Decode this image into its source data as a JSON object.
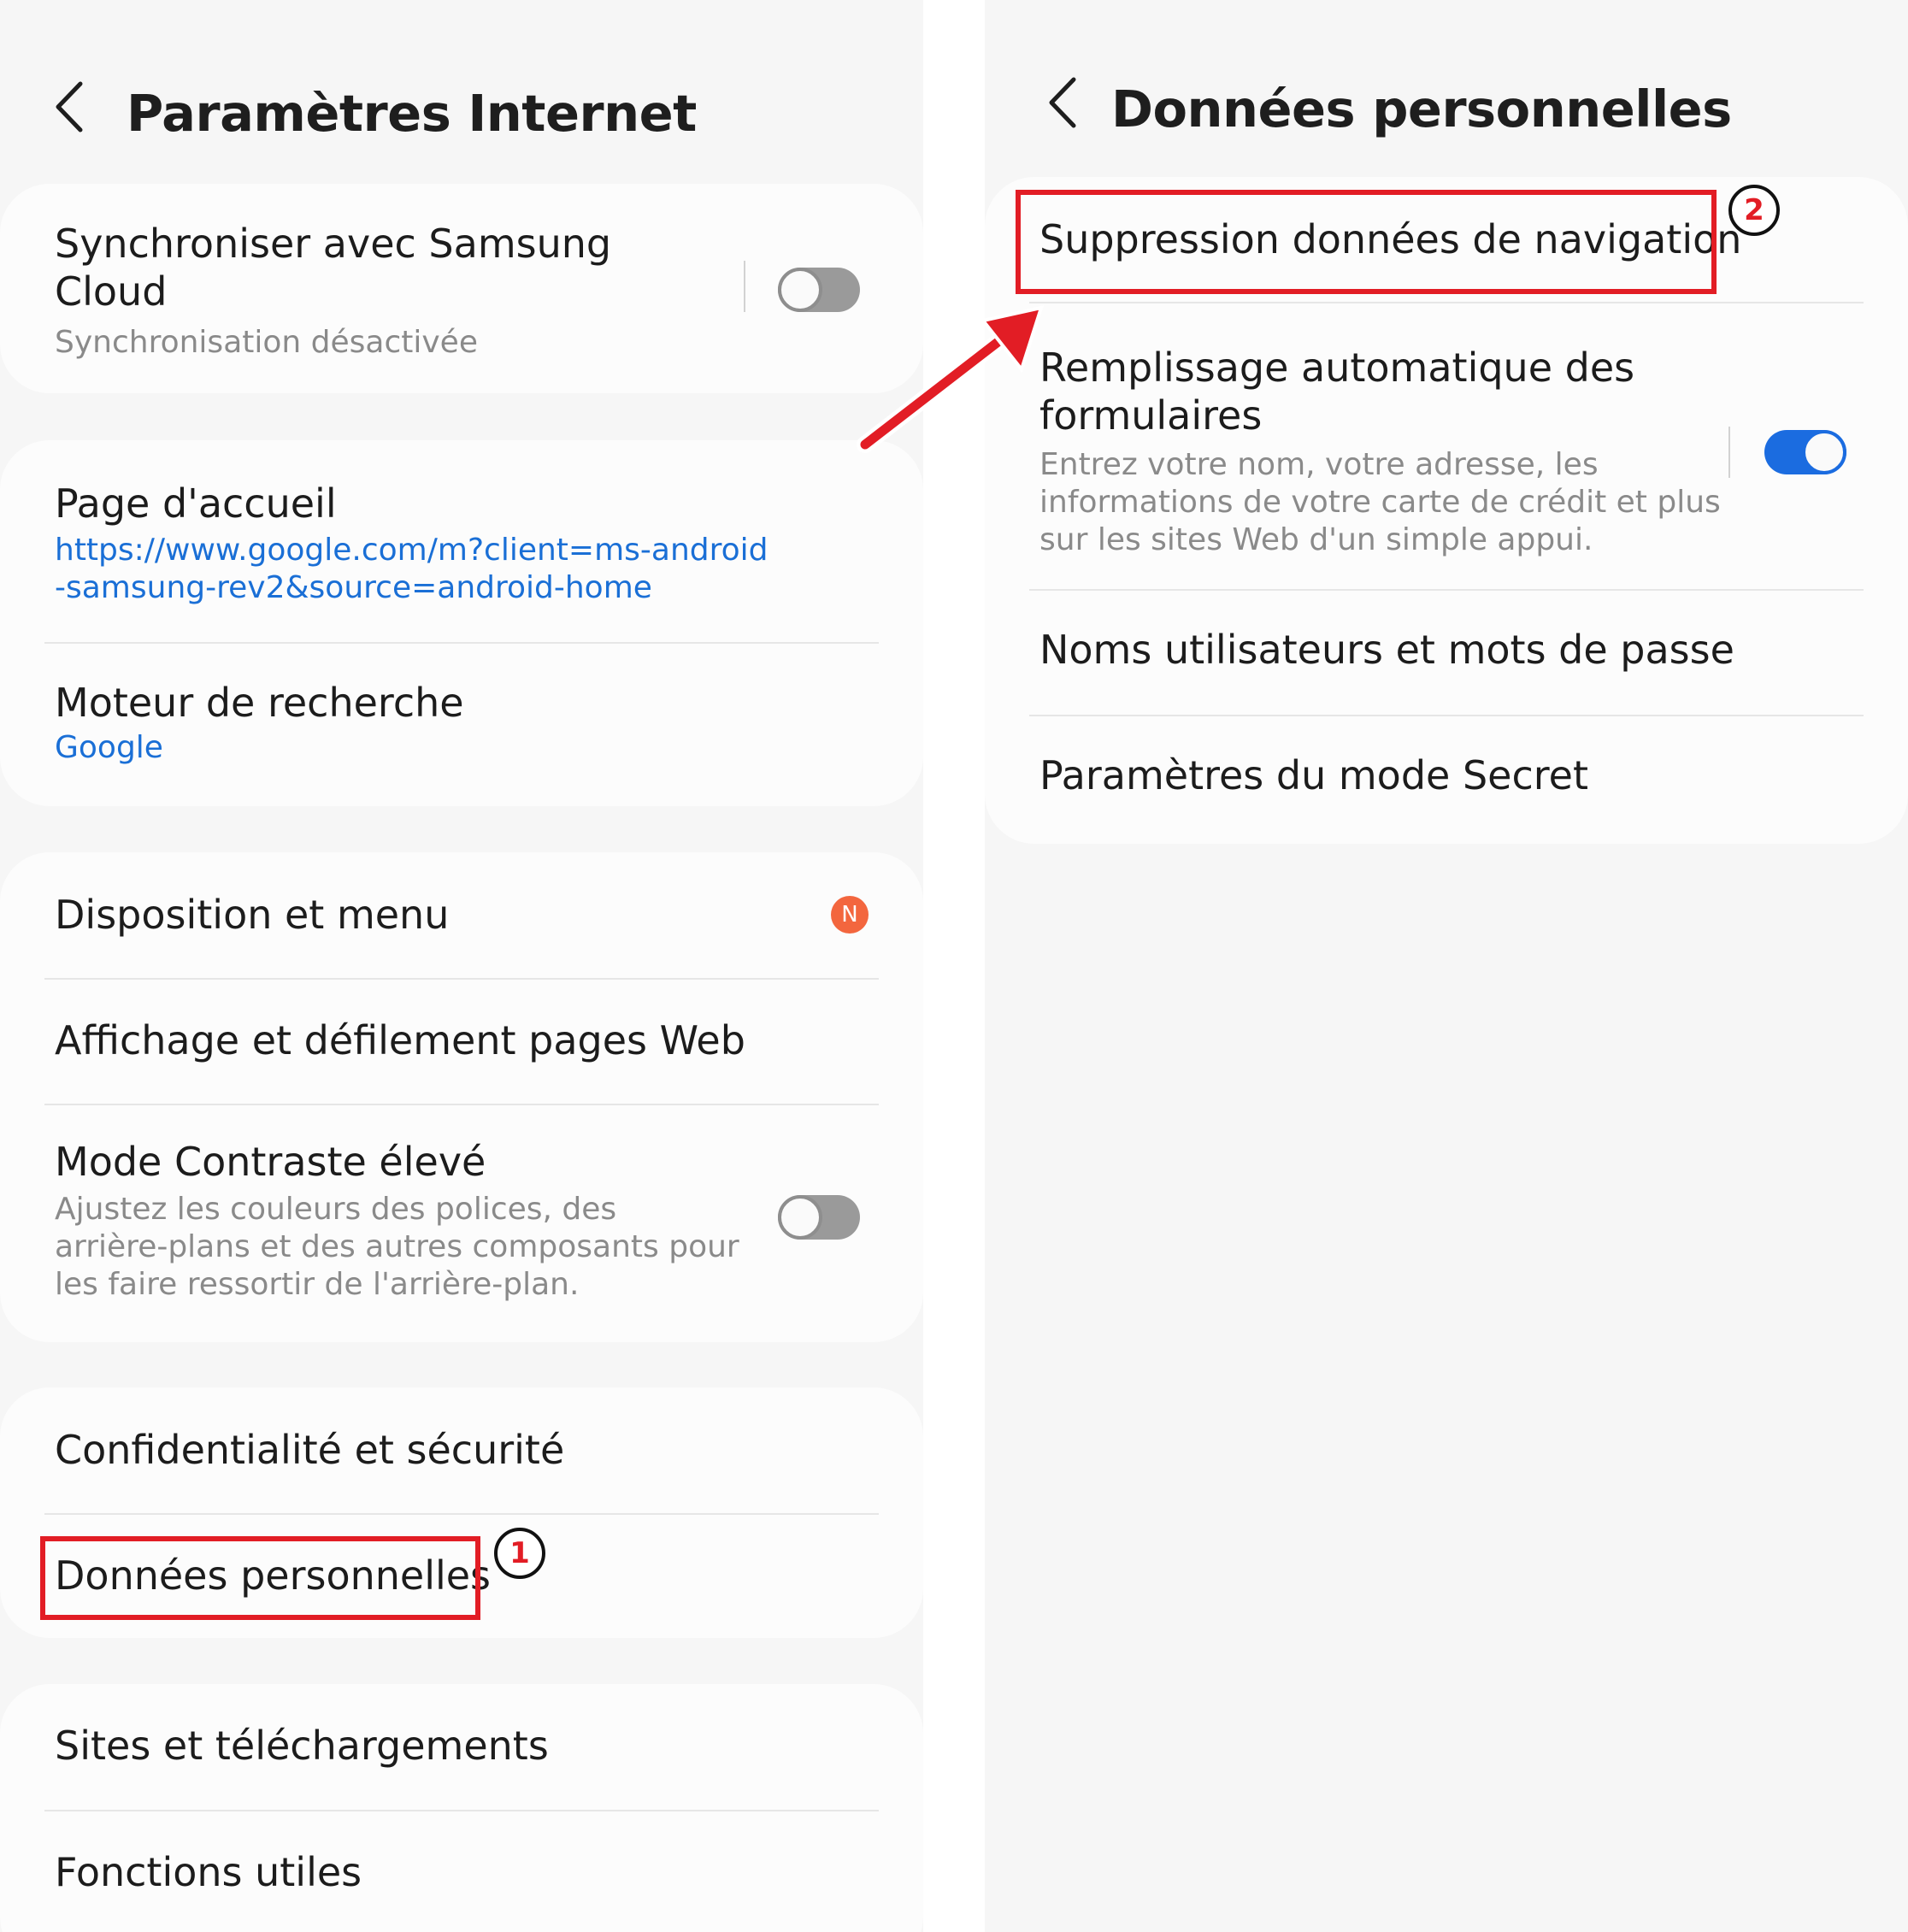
{
  "left_panel": {
    "title": "Paramètres Internet",
    "sync": {
      "title_line1": "Synchroniser avec Samsung",
      "title_line2": "Cloud",
      "subtitle": "Synchronisation désactivée",
      "toggle_on": false
    },
    "homepage": {
      "title": "Page d'accueil",
      "url_line1": "https://www.google.com/m?client=ms-android",
      "url_line2": "-samsung-rev2&source=android-home"
    },
    "search_engine": {
      "title": "Moteur de recherche",
      "value": "Google"
    },
    "layout_menu": {
      "title": "Disposition et menu",
      "badge": "N"
    },
    "display_scroll": {
      "title": "Affichage et défilement pages Web"
    },
    "high_contrast": {
      "title": "Mode Contraste élevé",
      "desc_line1": "Ajustez les couleurs des polices, des",
      "desc_line2": "arrière-plans et des autres composants pour",
      "desc_line3": "les faire ressortir de l'arrière-plan.",
      "toggle_on": false
    },
    "privacy_security": {
      "title": "Confidentialité et sécurité"
    },
    "personal_data": {
      "title": "Données personnelles"
    },
    "sites_downloads": {
      "title": "Sites et téléchargements"
    },
    "useful_features": {
      "title": "Fonctions utiles"
    }
  },
  "right_panel": {
    "title": "Données personnelles",
    "delete_browsing_data": {
      "title": "Suppression données de navigation"
    },
    "autofill": {
      "title_line1": "Remplissage automatique des",
      "title_line2": "formulaires",
      "desc_line1": "Entrez votre nom, votre adresse, les",
      "desc_line2": "informations de votre carte de crédit et plus",
      "desc_line3": "sur les sites Web d'un simple appui.",
      "toggle_on": true
    },
    "usernames_passwords": {
      "title": "Noms utilisateurs et mots de passe"
    },
    "secret_mode_settings": {
      "title": "Paramètres du mode Secret"
    }
  },
  "annotations": {
    "step1": "1",
    "step2": "2",
    "highlight_color": "#e21d25",
    "arrow_color": "#e21d25"
  },
  "colors": {
    "link": "#1a6fd6",
    "toggle_on": "#1b6ce0",
    "badge": "#f3663e",
    "background": "#f6f6f6",
    "card": "#fcfcfc"
  }
}
